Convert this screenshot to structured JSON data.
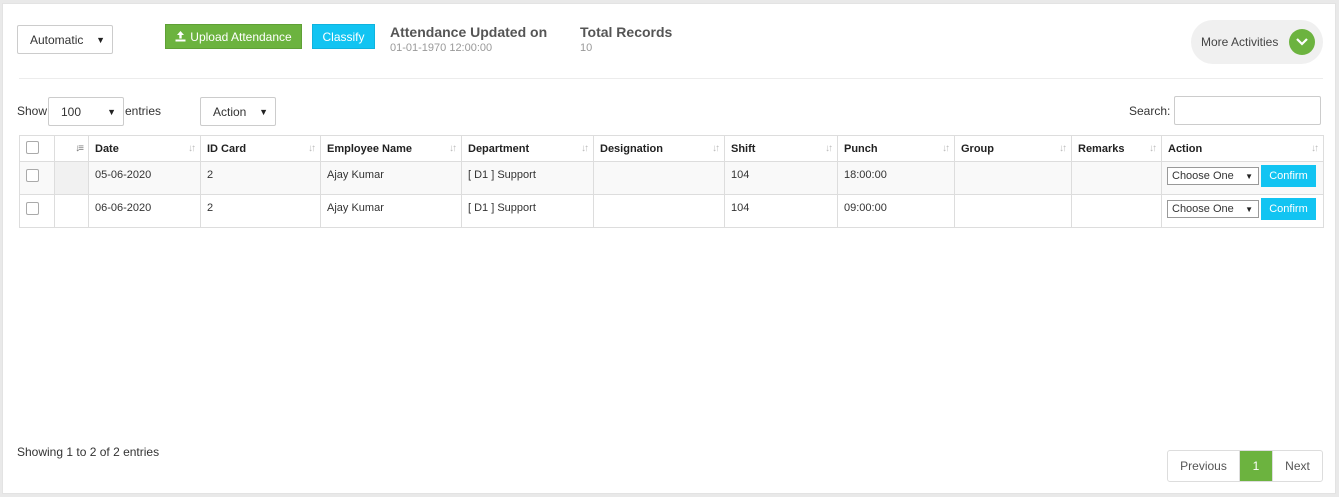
{
  "mode_select": {
    "value": "Automatic"
  },
  "buttons": {
    "upload": "Upload Attendance",
    "classify": "Classify"
  },
  "attendance_updated": {
    "title": "Attendance Updated on",
    "value": "01-01-1970 12:00:00"
  },
  "total_records": {
    "title": "Total Records",
    "value": "10"
  },
  "more_activities": {
    "label": "More Activities"
  },
  "length_control": {
    "show": "Show",
    "value": "100",
    "entries": "entries"
  },
  "action_select": {
    "value": "Action"
  },
  "search": {
    "label": "Search:",
    "value": "",
    "placeholder": ""
  },
  "table": {
    "columns": [
      "Date",
      "ID Card",
      "Employee Name",
      "Department",
      "Designation",
      "Shift",
      "Punch",
      "Group",
      "Remarks",
      "Action"
    ],
    "rows": [
      {
        "date": "05-06-2020",
        "id_card": "2",
        "employee_name": "Ajay Kumar",
        "department": "[ D1 ] Support",
        "designation": "",
        "shift": "104",
        "punch": "18:00:00",
        "group": "",
        "remarks": "",
        "choose": "Choose One",
        "confirm": "Confirm"
      },
      {
        "date": "06-06-2020",
        "id_card": "2",
        "employee_name": "Ajay Kumar",
        "department": "[ D1 ] Support",
        "designation": "",
        "shift": "104",
        "punch": "09:00:00",
        "group": "",
        "remarks": "",
        "choose": "Choose One",
        "confirm": "Confirm"
      }
    ]
  },
  "footer": {
    "info": "Showing 1 to 2 of 2 entries"
  },
  "pagination": {
    "previous": "Previous",
    "current": "1",
    "next": "Next"
  },
  "colors": {
    "green": "#6cb33f",
    "cyan": "#12c4f2"
  }
}
